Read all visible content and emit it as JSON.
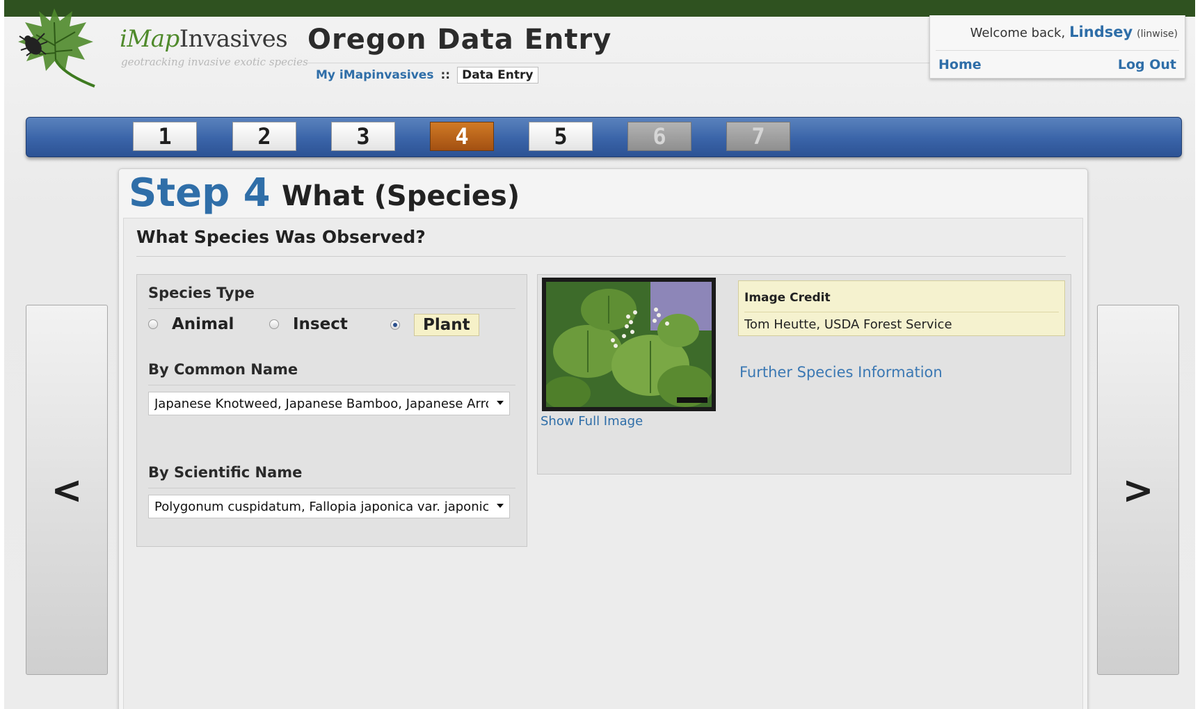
{
  "header": {
    "brand_prefix": "iMap",
    "brand_suffix": "Invasives",
    "brand_tagline": "geotracking invasive exotic species",
    "app_title": "Oregon Data Entry",
    "breadcrumb": {
      "home": "My iMapinvasives",
      "separator": "::",
      "current": "Data Entry"
    }
  },
  "user": {
    "greeting": "Welcome back,",
    "name": "Lindsey",
    "username": "(linwise)",
    "home_label": "Home",
    "logout_label": "Log Out"
  },
  "steps": [
    {
      "label": "1",
      "state": "normal"
    },
    {
      "label": "2",
      "state": "normal"
    },
    {
      "label": "3",
      "state": "normal"
    },
    {
      "label": "4",
      "state": "active"
    },
    {
      "label": "5",
      "state": "normal"
    },
    {
      "label": "6",
      "state": "disabled"
    },
    {
      "label": "7",
      "state": "disabled"
    }
  ],
  "nav": {
    "prev": "<",
    "next": ">"
  },
  "step_header": {
    "number": "Step 4",
    "title": "What (Species)"
  },
  "question": "What Species Was Observed?",
  "species_type": {
    "label": "Species Type",
    "options": [
      {
        "label": "Animal",
        "checked": false
      },
      {
        "label": "Insect",
        "checked": false
      },
      {
        "label": "Plant",
        "checked": true
      }
    ]
  },
  "common_name": {
    "label": "By Common Name",
    "value": "Japanese Knotweed, Japanese Bamboo, Japanese Arrowwood"
  },
  "scientific_name": {
    "label": "By Scientific Name",
    "value": "Polygonum cuspidatum, Fallopia japonica var. japonica"
  },
  "image": {
    "show_full": "Show Full Image",
    "credit_title": "Image Credit",
    "credit_name": "Tom Heutte, USDA Forest Service",
    "further_info": "Further Species Information"
  },
  "colors": {
    "topbar": "#2f5220",
    "link": "#2f6ea8",
    "stepbar": "#3a64a8",
    "active_step": "#c06b1e",
    "credit_bg": "#f5f2cf"
  }
}
